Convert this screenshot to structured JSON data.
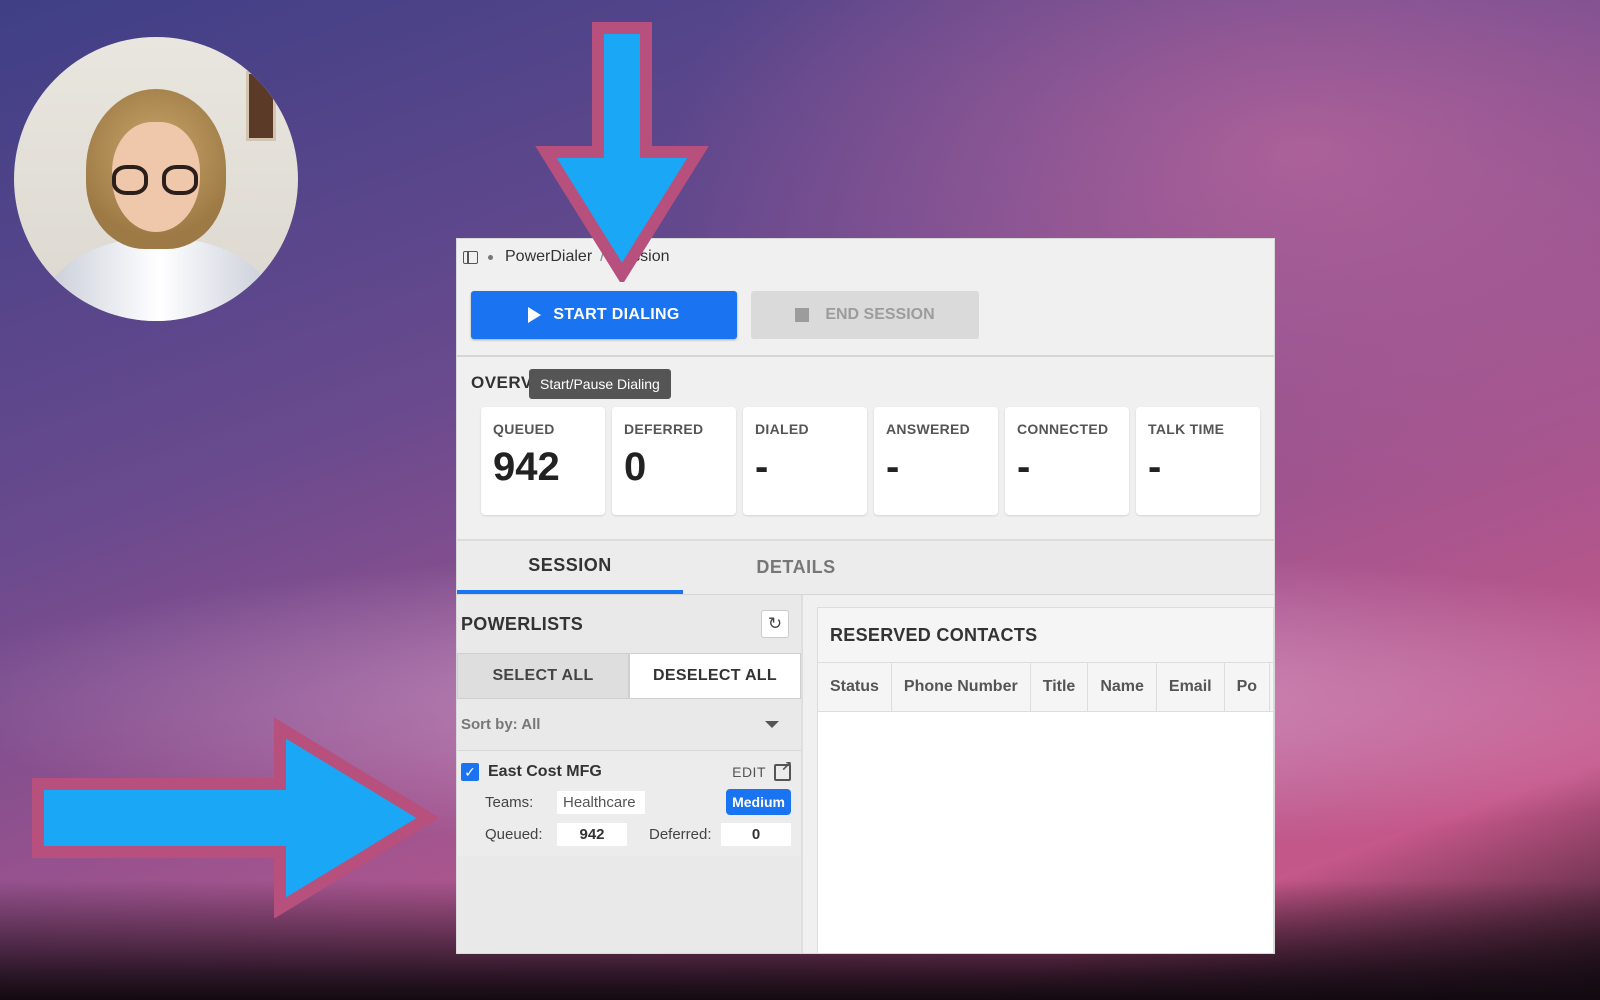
{
  "window": {
    "breadcrumb": [
      "PowerDialer",
      "Session"
    ]
  },
  "toolbar": {
    "start_label": "START DIALING",
    "end_label": "END SESSION",
    "tooltip": "Start/Pause Dialing"
  },
  "overview": {
    "title": "OVERVIEW",
    "stats": [
      {
        "label": "QUEUED",
        "value": "942"
      },
      {
        "label": "DEFERRED",
        "value": "0"
      },
      {
        "label": "DIALED",
        "value": "-"
      },
      {
        "label": "ANSWERED",
        "value": "-"
      },
      {
        "label": "CONNECTED",
        "value": "-"
      },
      {
        "label": "TALK TIME",
        "value": "-"
      }
    ]
  },
  "tabs": [
    {
      "label": "SESSION",
      "active": true
    },
    {
      "label": "DETAILS",
      "active": false
    }
  ],
  "powerlists": {
    "title": "POWERLISTS",
    "select_all": "SELECT ALL",
    "deselect_all": "DESELECT ALL",
    "sort_label": "Sort by: All",
    "items": [
      {
        "name": "East Cost MFG",
        "edit_label": "EDIT",
        "teams_label": "Teams:",
        "teams_value": "Healthcare",
        "priority": "Medium",
        "queued_label": "Queued:",
        "queued_value": "942",
        "deferred_label": "Deferred:",
        "deferred_value": "0"
      }
    ]
  },
  "reserved_contacts": {
    "title": "RESERVED CONTACTS",
    "columns": [
      "Status",
      "Phone Number",
      "Title",
      "Name",
      "Email",
      "Po"
    ]
  },
  "colors": {
    "accent": "#1a73f0",
    "arrow_fill": "#1aa7f5",
    "arrow_stroke": "#b8507e"
  }
}
